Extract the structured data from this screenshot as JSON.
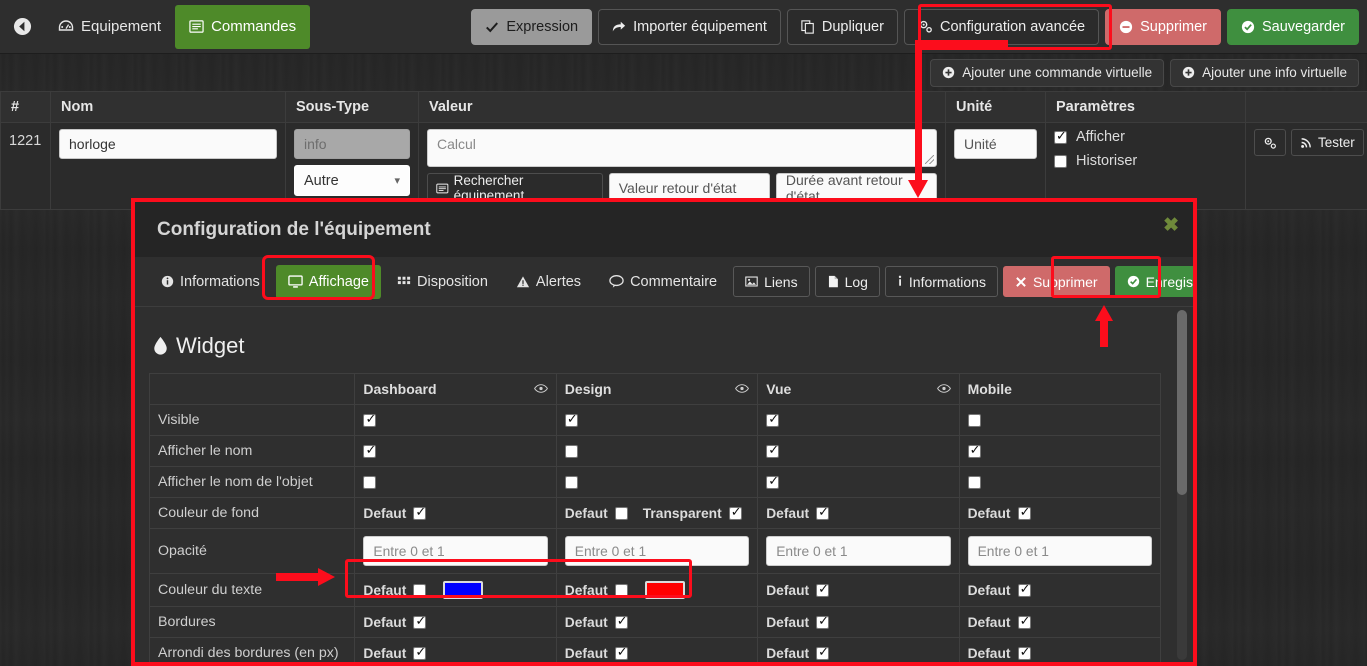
{
  "toolbar": {
    "back_icon": "back-circle-icon",
    "tabs": [
      {
        "label": "Equipement",
        "icon": "dashboard-icon",
        "active": false
      },
      {
        "label": "Commandes",
        "icon": "list-icon",
        "active": true
      }
    ],
    "actions": [
      {
        "label": "Expression",
        "icon": "check-icon",
        "style": "light"
      },
      {
        "label": "Importer équipement",
        "icon": "share-icon",
        "style": "dark"
      },
      {
        "label": "Dupliquer",
        "icon": "copy-icon",
        "style": "dark"
      },
      {
        "label": "Configuration avancée",
        "icon": "gears-icon",
        "style": "dark"
      },
      {
        "label": "Supprimer",
        "icon": "minus-circle-icon",
        "style": "danger"
      },
      {
        "label": "Sauvegarder",
        "icon": "check-circle-icon",
        "style": "success"
      }
    ]
  },
  "subbar": {
    "buttons": [
      {
        "label": "Ajouter une commande virtuelle",
        "icon": "plus-circle-icon"
      },
      {
        "label": "Ajouter une info virtuelle",
        "icon": "plus-circle-icon"
      }
    ]
  },
  "command_table": {
    "headers": [
      "#",
      "Nom",
      "Sous-Type",
      "Valeur",
      "Unité",
      "Paramètres",
      ""
    ],
    "row": {
      "id": "1221",
      "name_value": "horloge",
      "subtype_disabled_value": "info",
      "subtype_select_value": "Autre",
      "calcul_placeholder": "Calcul",
      "search_button_label": "Rechercher équipement",
      "search_button_icon": "list-alt-icon",
      "etat_placeholder": "Valeur retour d'état",
      "duree_placeholder": "Durée avant retour d'état",
      "unite_placeholder": "Unité",
      "params": [
        {
          "label": "Afficher",
          "checked": true
        },
        {
          "label": "Historiser",
          "checked": false
        }
      ],
      "gear_icon": "gears-icon",
      "test_label": "Tester",
      "test_icon": "rss-icon",
      "remove_icon": "minus-circle-icon"
    }
  },
  "modal": {
    "title": "Configuration de l'équipement",
    "close_icon": "close-icon",
    "tabs": [
      {
        "label": "Informations",
        "icon": "info-circle-icon",
        "active": false
      },
      {
        "label": "Affichage",
        "icon": "desktop-icon",
        "active": true
      },
      {
        "label": "Disposition",
        "icon": "grid-icon",
        "active": false
      },
      {
        "label": "Alertes",
        "icon": "warning-icon",
        "active": false
      },
      {
        "label": "Commentaire",
        "icon": "comment-icon",
        "active": false
      }
    ],
    "actions": [
      {
        "label": "Liens",
        "icon": "picture-icon",
        "style": "default"
      },
      {
        "label": "Log",
        "icon": "file-icon",
        "style": "default"
      },
      {
        "label": "Informations",
        "icon": "info-icon",
        "style": "default"
      },
      {
        "label": "Supprimer",
        "icon": "times-icon",
        "style": "danger"
      },
      {
        "label": "Enregistrer",
        "icon": "check-circle-icon",
        "style": "success"
      }
    ],
    "widget": {
      "section_title": "Widget",
      "section_icon": "droplet-icon",
      "columns": [
        "",
        "Dashboard",
        "Design",
        "Vue",
        "Mobile"
      ],
      "column_eye_icon": "eye-icon",
      "rows": [
        {
          "label": "Visible",
          "type": "checkbox",
          "cells": [
            {
              "checked": true
            },
            {
              "checked": true
            },
            {
              "checked": true
            },
            {
              "checked": false
            }
          ]
        },
        {
          "label": "Afficher le nom",
          "type": "checkbox",
          "cells": [
            {
              "checked": true
            },
            {
              "checked": false
            },
            {
              "checked": true
            },
            {
              "checked": true
            }
          ]
        },
        {
          "label": "Afficher le nom de l'objet",
          "type": "checkbox",
          "cells": [
            {
              "checked": false
            },
            {
              "checked": false
            },
            {
              "checked": true
            },
            {
              "checked": false
            }
          ]
        },
        {
          "label": "Couleur de fond",
          "type": "default",
          "cells": [
            {
              "default_label": "Defaut",
              "checked": true
            },
            {
              "default_label": "Defaut",
              "checked": false,
              "extra_label": "Transparent",
              "extra_checked": true
            },
            {
              "default_label": "Defaut",
              "checked": true
            },
            {
              "default_label": "Defaut",
              "checked": true
            }
          ]
        },
        {
          "label": "Opacité",
          "type": "input",
          "cells": [
            {
              "placeholder": "Entre 0 et 1"
            },
            {
              "placeholder": "Entre 0 et 1"
            },
            {
              "placeholder": "Entre 0 et 1"
            },
            {
              "placeholder": "Entre 0 et 1"
            }
          ]
        },
        {
          "label": "Couleur du texte",
          "type": "color",
          "cells": [
            {
              "default_label": "Defaut",
              "checked": false,
              "color": "#0000ff"
            },
            {
              "default_label": "Defaut",
              "checked": false,
              "color": "#ff0000"
            },
            {
              "default_label": "Defaut",
              "checked": true
            },
            {
              "default_label": "Defaut",
              "checked": true
            }
          ]
        },
        {
          "label": "Bordures",
          "type": "default",
          "cells": [
            {
              "default_label": "Defaut",
              "checked": true
            },
            {
              "default_label": "Defaut",
              "checked": true
            },
            {
              "default_label": "Defaut",
              "checked": true
            },
            {
              "default_label": "Defaut",
              "checked": true
            }
          ]
        },
        {
          "label": "Arrondi des bordures (en px)",
          "type": "default",
          "cells": [
            {
              "default_label": "Defaut",
              "checked": true
            },
            {
              "default_label": "Defaut",
              "checked": true
            },
            {
              "default_label": "Defaut",
              "checked": true
            },
            {
              "default_label": "Defaut",
              "checked": true
            }
          ]
        }
      ]
    }
  },
  "annotations": {
    "highlight_color": "#fc0d1c",
    "items": [
      {
        "name": "configuration-avancee-highlight"
      },
      {
        "name": "affichage-tab-highlight"
      },
      {
        "name": "enregistrer-button-highlight"
      },
      {
        "name": "couleur-du-texte-highlight"
      },
      {
        "name": "arrow-from-config-to-modal"
      },
      {
        "name": "arrow-to-enregistrer"
      },
      {
        "name": "arrow-to-couleur-du-texte"
      }
    ]
  }
}
